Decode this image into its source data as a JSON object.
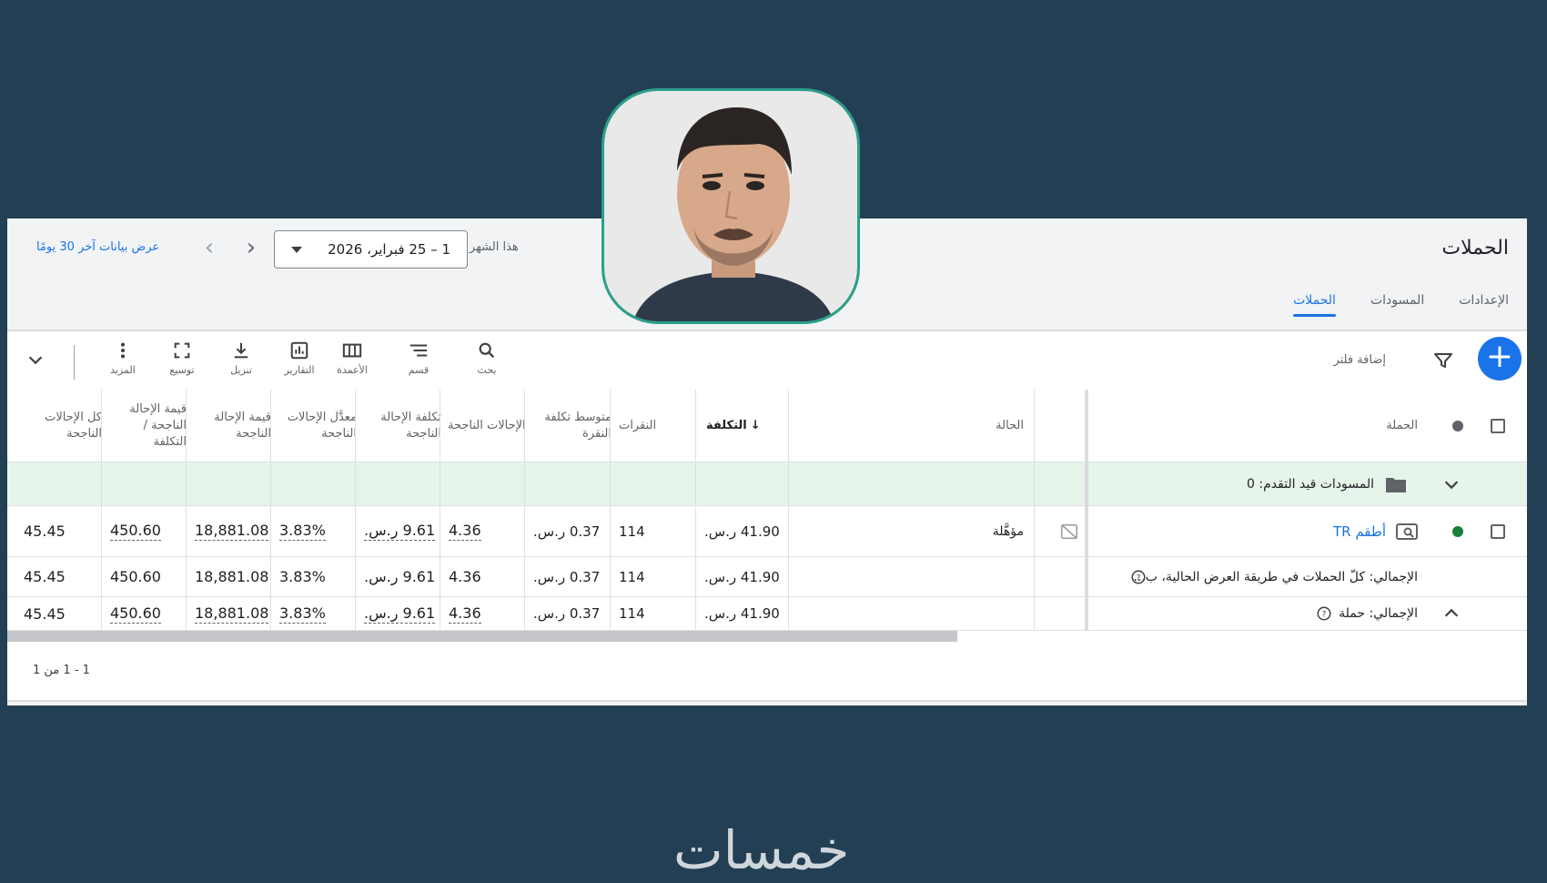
{
  "page": {
    "title": "الحملات",
    "tabs": [
      {
        "label": "الحملات",
        "active": true
      },
      {
        "label": "المسودات",
        "active": false
      },
      {
        "label": "الإعدادات",
        "active": false
      }
    ]
  },
  "date": {
    "label": "هذا الشهر",
    "range": "1 – 25 فبراير، 2026",
    "compare_link": "عرض بيانات آخر 30 يومًا"
  },
  "toolbar": {
    "add_filter": "إضافة فلتر",
    "search": "بحث",
    "segment": "قسم",
    "columns": "الأعمدة",
    "reports": "التقارير",
    "download": "تنزيل",
    "expand": "توسيع",
    "more": "المزيد"
  },
  "table": {
    "headers": {
      "campaign": "الحملة",
      "status": "الحالة",
      "cost": "التكلفة",
      "clicks": "النقرات",
      "avg_cpc": "متوسط تكلفة النقرة",
      "conversions": "الإحالات الناجحة",
      "cost_per_conv": "تكلفة الإحالة الناجحة",
      "conv_rate": "معدَّل الإحالات الناجحة",
      "conv_value": "قيمة الإحالة الناجحة",
      "conv_value_cost": "قيمة الإحالة الناجحة / التكلفة",
      "all_conv": "كل الإحالات الناجحة"
    },
    "drafts_row": "المسودات قيد التقدم: 0",
    "campaign_row": {
      "name": "أطقم TR",
      "status": "مؤهَّلة",
      "cost": "41.90 ر.س.",
      "clicks": "114",
      "avg_cpc": "0.37 ر.س.",
      "conversions": "4.36",
      "cost_per_conv": "9.61 ر.س.",
      "conv_rate": "3.83%",
      "conv_value": "18,881.08",
      "conv_value_cost": "450.60",
      "all_conv": "45.45"
    },
    "total_all_row": {
      "label": "الإجمالي: كلّ الحملات في طريقة العرض الحالية، ب...",
      "cost": "41.90 ر.س.",
      "clicks": "114",
      "avg_cpc": "0.37 ر.س.",
      "conversions": "4.36",
      "cost_per_conv": "9.61 ر.س.",
      "conv_rate": "3.83%",
      "conv_value": "18,881.08",
      "conv_value_cost": "450.60",
      "all_conv": "45.45"
    },
    "total_campaign_row": {
      "label": "الإجمالي: حملة",
      "cost": "41.90 ر.س.",
      "clicks": "114",
      "avg_cpc": "0.37 ر.س.",
      "conversions": "4.36",
      "cost_per_conv": "9.61 ر.س.",
      "conv_rate": "3.83%",
      "conv_value": "18,881.08",
      "conv_value_cost": "450.60",
      "all_conv": "45.45"
    },
    "pagination": "1 - 1 من 1"
  },
  "brand": "خمسات",
  "colors": {
    "background": "#233f53",
    "accent": "#1a73e8",
    "drafts_row_bg": "#e6f4ea",
    "enabled_dot": "#188038",
    "avatar_border": "#2aa08a"
  }
}
